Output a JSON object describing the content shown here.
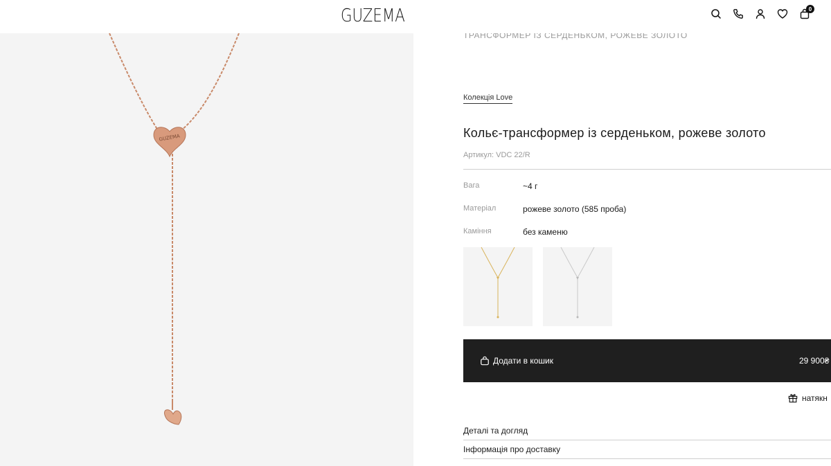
{
  "header": {
    "logo": "GUZEMA",
    "icons": [
      "search-icon",
      "phone-icon",
      "user-icon",
      "heart-icon",
      "bag-icon"
    ],
    "cart_count": "0"
  },
  "product": {
    "previous_title": "ТРАНСФОРМЕР ІЗ СЕРДЕНЬКОМ, РОЖЕВЕ ЗОЛОТО",
    "collection": "Колекція Love",
    "title": "Кольє-трансформер із серденьком, рожеве золото",
    "sku": "Артикул: VDC 22/R",
    "specs": [
      {
        "label": "Вага",
        "value": "~4 г"
      },
      {
        "label": "Матеріал",
        "value": "рожеве золото (585 проба)"
      },
      {
        "label": "Каміння",
        "value": "без каменю"
      }
    ],
    "variants": [
      {
        "name": "yellow-gold",
        "color": "#d9b35a"
      },
      {
        "name": "white-gold",
        "color": "#c9c9c9"
      }
    ],
    "image_chain_color": "#c98a6a",
    "image_heart_text": "GUZEMA"
  },
  "cart": {
    "button_label": "Додати в кошик",
    "price": "29 900₴"
  },
  "gift": {
    "label": "натякн"
  },
  "accordion": [
    {
      "label": "Деталі та догляд"
    },
    {
      "label": "Інформація про доставку"
    }
  ]
}
